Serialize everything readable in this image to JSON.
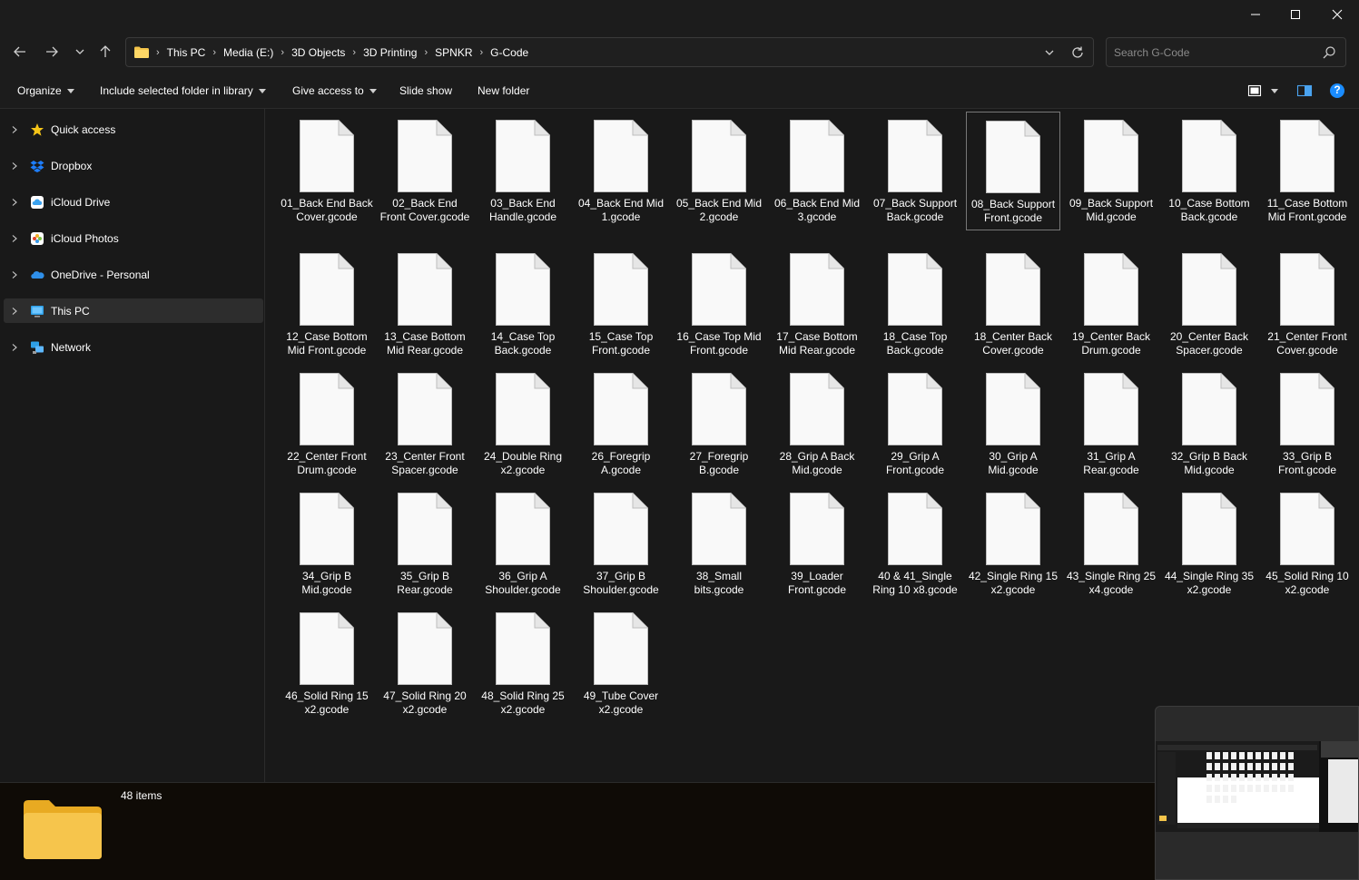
{
  "window": {
    "minimize": "─",
    "maximize": "☐",
    "close": "✕"
  },
  "nav": {
    "back": "back",
    "forward": "forward",
    "recent": "recent-locations",
    "up": "up"
  },
  "breadcrumbs": [
    "This PC",
    "Media (E:)",
    "3D Objects",
    "3D Printing",
    "SPNKR",
    "G-Code"
  ],
  "search": {
    "placeholder": "Search G-Code",
    "value": ""
  },
  "commands": {
    "organize": "Organize",
    "include_library": "Include selected folder in library",
    "give_access": "Give access to",
    "slide_show": "Slide show",
    "new_folder": "New folder",
    "help": "?"
  },
  "sidebar": [
    {
      "label": "Quick access",
      "icon": "star-icon",
      "color": "#f5c518"
    },
    {
      "label": "Dropbox",
      "icon": "dropbox-icon",
      "color": "#1e7dfa"
    },
    {
      "label": "iCloud Drive",
      "icon": "icloud-drive-icon",
      "color": "#3ba3f0"
    },
    {
      "label": "iCloud Photos",
      "icon": "icloud-photos-icon",
      "color": "#e25a2b"
    },
    {
      "label": "OneDrive - Personal",
      "icon": "onedrive-icon",
      "color": "#2f8fe8"
    },
    {
      "label": "This PC",
      "icon": "this-pc-icon",
      "color": "#2ea0e8",
      "selected": true
    },
    {
      "label": "Network",
      "icon": "network-icon",
      "color": "#2ea0e8"
    }
  ],
  "files": [
    {
      "name": "01_Back End Back Cover.gcode"
    },
    {
      "name": "02_Back End Front Cover.gcode"
    },
    {
      "name": "03_Back End Handle.gcode"
    },
    {
      "name": "04_Back End Mid 1.gcode"
    },
    {
      "name": "05_Back End Mid 2.gcode"
    },
    {
      "name": "06_Back End Mid 3.gcode"
    },
    {
      "name": "07_Back Support Back.gcode"
    },
    {
      "name": "08_Back Support Front.gcode",
      "selected": true
    },
    {
      "name": "09_Back Support Mid.gcode"
    },
    {
      "name": "10_Case Bottom Back.gcode"
    },
    {
      "name": "11_Case Bottom Mid Front.gcode"
    },
    {
      "name": "12_Case Bottom Mid Front.gcode"
    },
    {
      "name": "13_Case Bottom Mid Rear.gcode"
    },
    {
      "name": "14_Case Top Back.gcode"
    },
    {
      "name": "15_Case Top Front.gcode"
    },
    {
      "name": "16_Case Top Mid Front.gcode"
    },
    {
      "name": "17_Case Bottom Mid Rear.gcode"
    },
    {
      "name": "18_Case Top Back.gcode"
    },
    {
      "name": "18_Center Back Cover.gcode"
    },
    {
      "name": "19_Center Back Drum.gcode"
    },
    {
      "name": "20_Center Back Spacer.gcode"
    },
    {
      "name": "21_Center Front Cover.gcode"
    },
    {
      "name": "22_Center Front Drum.gcode"
    },
    {
      "name": "23_Center Front Spacer.gcode"
    },
    {
      "name": "24_Double Ring x2.gcode"
    },
    {
      "name": "26_Foregrip A.gcode"
    },
    {
      "name": "27_Foregrip B.gcode"
    },
    {
      "name": "28_Grip A Back Mid.gcode"
    },
    {
      "name": "29_Grip A Front.gcode"
    },
    {
      "name": "30_Grip A Mid.gcode"
    },
    {
      "name": "31_Grip A Rear.gcode"
    },
    {
      "name": "32_Grip B Back Mid.gcode"
    },
    {
      "name": "33_Grip B Front.gcode"
    },
    {
      "name": "34_Grip B Mid.gcode"
    },
    {
      "name": "35_Grip B Rear.gcode"
    },
    {
      "name": "36_Grip A Shoulder.gcode"
    },
    {
      "name": "37_Grip B Shoulder.gcode"
    },
    {
      "name": "38_Small bits.gcode"
    },
    {
      "name": "39_Loader Front.gcode"
    },
    {
      "name": "40 & 41_Single Ring 10 x8.gcode"
    },
    {
      "name": "42_Single Ring 15 x2.gcode"
    },
    {
      "name": "43_Single Ring 25 x4.gcode"
    },
    {
      "name": "44_Single Ring 35 x2.gcode"
    },
    {
      "name": "45_Solid Ring 10 x2.gcode"
    },
    {
      "name": "46_Solid Ring 15 x2.gcode"
    },
    {
      "name": "47_Solid Ring 20 x2.gcode"
    },
    {
      "name": "48_Solid Ring 25 x2.gcode"
    },
    {
      "name": "49_Tube Cover x2.gcode"
    }
  ],
  "details": {
    "count": "48 items"
  },
  "colors": {
    "folder": "#f4c44a",
    "file_page": "#f9f9f9",
    "help": "#1a8cff"
  }
}
